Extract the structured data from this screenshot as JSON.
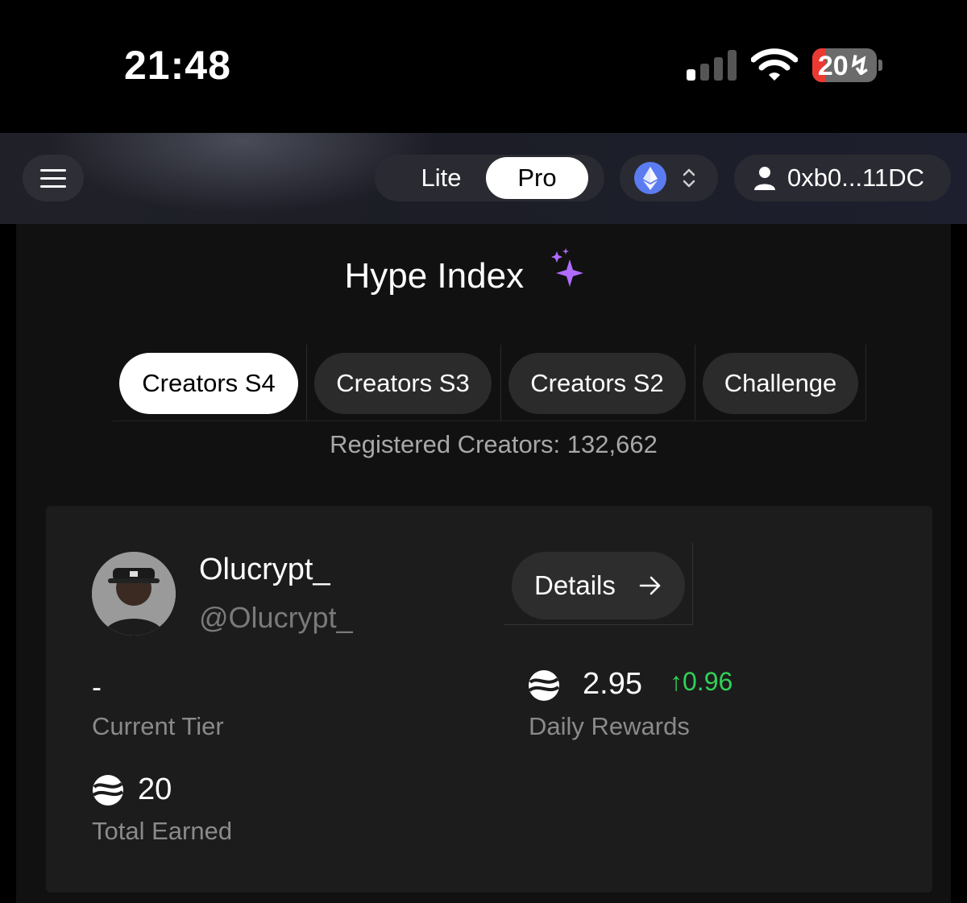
{
  "status_bar": {
    "time": "21:48",
    "battery": "20",
    "battery_level": 0.2
  },
  "nav": {
    "mode_options": [
      "Lite",
      "Pro"
    ],
    "active_mode": "Pro",
    "chain": "ethereum",
    "wallet_address": "0xb0...11DC"
  },
  "page": {
    "title": "Hype Index",
    "tabs": [
      {
        "label": "Creators S4",
        "active": true
      },
      {
        "label": "Creators S3",
        "active": false
      },
      {
        "label": "Creators S2",
        "active": false
      },
      {
        "label": "Challenge",
        "active": false
      }
    ],
    "registered_creators": "Registered Creators: 132,662"
  },
  "profile_card": {
    "display_name": "Olucrypt_",
    "handle": "@Olucrypt_",
    "details_label": "Details",
    "current_tier_value": "-",
    "current_tier_label": "Current Tier",
    "daily_rewards_value": "2.95",
    "daily_rewards_delta": "0.96",
    "daily_rewards_label": "Daily Rewards",
    "total_earned_value": "20",
    "total_earned_label": "Total Earned"
  },
  "colors": {
    "accent_positive": "#31d158",
    "sparkle": "#b06cff",
    "eth": "#5b7cf0"
  }
}
